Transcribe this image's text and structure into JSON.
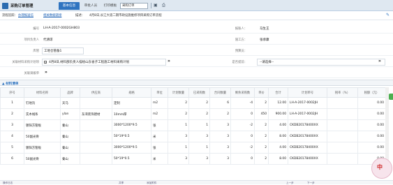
{
  "app": {
    "title": "采购订单管理"
  },
  "tabs": [
    {
      "label": "基本信息",
      "active": true
    },
    {
      "label": "审批人员",
      "active": false
    }
  ],
  "toolbar": {
    "print_label": "打印模板",
    "print_select": "采购订单"
  },
  "flow": {
    "label": "流程追踪：",
    "link1": "办理报送信",
    "link2": "相关数据链接",
    "text_label": "描述：",
    "text": "4月8日,长江大道二期市政设施维修项目采购订单流程"
  },
  "form": {
    "rows": [
      {
        "label": "编号",
        "value": "LH-A-2017-0002GH803",
        "label2": "报账人：",
        "value2": "马生王"
      },
      {
        "label": "项目负责人",
        "value": "代清琼",
        "label2": "施工方：",
        "value2": "张承康"
      },
      {
        "label": "库管",
        "value": "工地仓管备1",
        "label2": "预算员：",
        "value2": ""
      },
      {
        "label": "关联材料采购计划项",
        "value": "4月8日,材料部负责人描绘山东省子工程施工材料采购计划",
        "label2": "是否提前：",
        "value2": "--请选择--"
      },
      {
        "label": "关联调拨单",
        "value": "",
        "label2": "",
        "value2": ""
      }
    ]
  },
  "section": {
    "title": "材料清单"
  },
  "table": {
    "headers": [
      "序号",
      "材料名称",
      "品牌",
      "供应商",
      "规格",
      "单位",
      "计划数量",
      "已采购数",
      "合同数量",
      "剩余采购数",
      "单价",
      "合计",
      "计划单号",
      "税率（%）",
      "税额（元）"
    ],
    "rows": [
      [
        "1",
        "钉地沟",
        "天马",
        "",
        "定制",
        "m2",
        "2",
        "2",
        "6",
        "-4",
        "2",
        "12.00",
        "LH-A-2017-0002JH",
        "",
        "0.00"
      ],
      [
        "2",
        "实木线条",
        "ylan",
        "东湾装饰建材",
        "10mm厚",
        "m2",
        "2",
        "2",
        "2",
        "0",
        "450",
        "900.00",
        "LH-A-2017-0002JH",
        "",
        "0.00"
      ],
      [
        "3",
        "镀锌方管板",
        "秦山",
        "",
        "3000*1200*9.5",
        "张",
        "1",
        "1",
        "3",
        "-2",
        "2",
        "4.00",
        "CKDB20178400XX",
        "",
        "0.00"
      ],
      [
        "4",
        "50副光骨",
        "秦山",
        "",
        "50*19*0.5",
        "米",
        "3",
        "3",
        "3",
        "0",
        "2",
        "8.00",
        "CKDB20178400XX",
        "",
        "0.00"
      ],
      [
        "5",
        "镀锌方管板",
        "秦山",
        "",
        "3000*1200*9.5",
        "张",
        "1",
        "1",
        "3",
        "-2",
        "2",
        "4.00",
        "CKDB20178400XX",
        "",
        "0.00"
      ],
      [
        "6",
        "50副光骨",
        "秦山",
        "",
        "50*19*0.5",
        "米",
        "3",
        "3",
        "3",
        "0",
        "2",
        "8.00",
        "CKDB20178400XX",
        "",
        "0.00"
      ]
    ]
  },
  "statusbar": {
    "items": [
      "操作日志",
      "共享",
      "添加附件",
      "上一步",
      "下一步"
    ]
  },
  "badge": {
    "text": "中"
  },
  "colors": {
    "accent": "#2f74c0",
    "header_bg": "#dfe8f1"
  }
}
